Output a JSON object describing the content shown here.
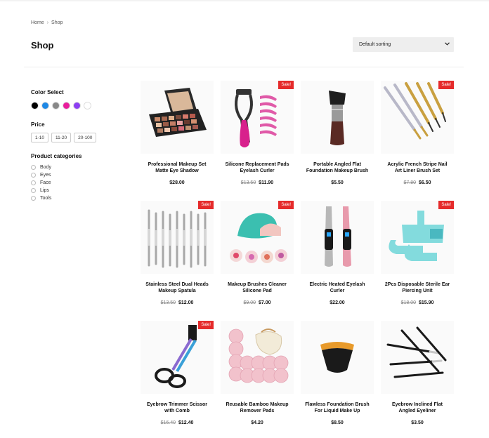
{
  "breadcrumb": {
    "home": "Home",
    "separator": "›",
    "current": "Shop"
  },
  "page": {
    "title": "Shop"
  },
  "sorting": {
    "selected": "Default sorting",
    "icon": "chevron-down-icon"
  },
  "sidebar": {
    "color_heading": "Color Select",
    "colors": [
      "#000000",
      "#1e88e5",
      "#888888",
      "#e91e9c",
      "#8c3ff2",
      "#ffffff"
    ],
    "price_heading": "Price",
    "price_ranges": [
      "1-10",
      "11-20",
      "20-100"
    ],
    "categories_heading": "Product categories",
    "categories": [
      "Body",
      "Eyes",
      "Face",
      "Lips",
      "Tools"
    ]
  },
  "sale_badge": "Sale!",
  "products": [
    {
      "name": "Professional Makeup Set Matte Eye Shadow",
      "old_price": "",
      "price": "$28.00",
      "sale": false
    },
    {
      "name": "Silicone Replacement Pads Eyelash Curler",
      "old_price": "$13.50",
      "price": "$11.90",
      "sale": true
    },
    {
      "name": "Portable Angled Flat Foundation Makeup Brush",
      "old_price": "",
      "price": "$5.50",
      "sale": false
    },
    {
      "name": "Acrylic French Stripe Nail Art Liner Brush Set",
      "old_price": "$7.80",
      "price": "$6.50",
      "sale": true
    },
    {
      "name": "Stainless Steel Dual Heads Makeup Spatula",
      "old_price": "$13.50",
      "price": "$12.00",
      "sale": true
    },
    {
      "name": "Makeup Brushes Cleaner Silicone Pad",
      "old_price": "$9.00",
      "price": "$7.00",
      "sale": true
    },
    {
      "name": "Electric Heated Eyelash Curler",
      "old_price": "",
      "price": "$22.00",
      "sale": false
    },
    {
      "name": "2Pcs Disposable Sterile Ear Piercing Unit",
      "old_price": "$18.00",
      "price": "$15.90",
      "sale": true
    },
    {
      "name": "Eyebrow Trimmer Scissor with Comb",
      "old_price": "$16.40",
      "price": "$12.40",
      "sale": true
    },
    {
      "name": "Reusable Bamboo Makeup Remover Pads",
      "old_price": "",
      "price": "$4.20",
      "sale": false
    },
    {
      "name": "Flawless Foundation Brush For Liquid Make Up",
      "old_price": "",
      "price": "$8.50",
      "sale": false
    },
    {
      "name": "Eyebrow Inclined Flat Angled Eyeliner",
      "old_price": "",
      "price": "$3.50",
      "sale": false
    }
  ]
}
